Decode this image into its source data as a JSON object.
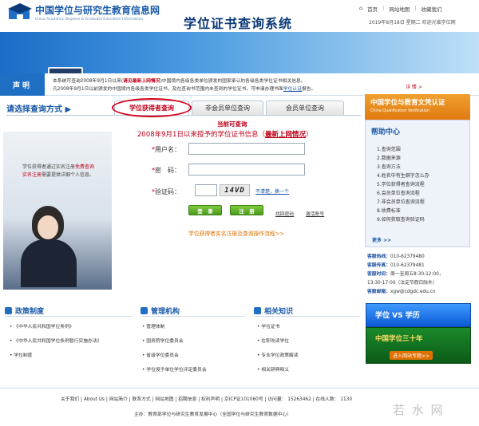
{
  "header": {
    "site_title": "中国学位与研究生教育信息网",
    "site_subtitle": "China Academic Degrees & Graduate Education Information",
    "top_links": [
      "首页",
      "网站地图",
      "收藏我们"
    ],
    "date": "2019年8月18日 星期二",
    "welcome": "欢迎光临学位网"
  },
  "banner": {
    "title": "学位证书查询系统"
  },
  "notice": {
    "label": "声明",
    "line1_a": "本系统可查询2008年9月1日以来(",
    "line1_link": "请见最新上网情况",
    "line1_b": ")中国境内各级各类单位颁发的国家承认的各级各类学位证书相关信息。",
    "line2_a": "凡2008年9月1日以前颁发的中国境内各级各类学位证书，及在查询书范围内未查到的学位证书，可申请办理书面",
    "line2_link": "学位认证",
    "line2_b": "报告。",
    "detail": "详 情 >"
  },
  "query": {
    "label": "请选择查询方式",
    "tabs": [
      "学位获得者查询",
      "非会员单位查询",
      "会员单位查询"
    ]
  },
  "photo": {
    "caption_a": "学位获得者通过实名注册",
    "caption_red": "免费查询",
    "caption_b": "实名注册",
    "caption_c": "需要提供详细个人信息。"
  },
  "form": {
    "current_label": "当前可查询",
    "scope_a": "2008年9月1日以来授予的学位证书信息（",
    "scope_link": "最新上网情况",
    "scope_b": "）",
    "user_label": "用户名：",
    "pwd_label": "密　码：",
    "captcha_label": "验证码：",
    "user_value": "",
    "pwd_value": "",
    "captcha_value": "",
    "captcha_text": "14VD",
    "refresh_text": "不清楚，换一个",
    "login_btn": "登　录",
    "register_btn": "注　册",
    "forgot_link": "找回密码",
    "activate_link": "激活账号",
    "process_link": "学位获得者实名注册及查询操作流程>>"
  },
  "right": {
    "cert_title": "中国学位与教育文凭认证",
    "cert_sub": "China Qualification Verification",
    "help_title": "帮助中心",
    "help_items": [
      "1.查询范围",
      "2.数据来源",
      "3.查询方法",
      "4.姓名中有生僻字怎么办",
      "5.学位获得者查询流程",
      "6.会员单位查询流程",
      "7.非会员单位查询流程",
      "8.收费标准",
      "9.如何获取查询验证码"
    ],
    "help_more": "更多 >>",
    "hotline_label": "客服热线：",
    "hotline": "010-62379480",
    "fax_label": "客服传真：",
    "fax": "010-62379481",
    "hours_label": "客服时间：",
    "hours_a": "周一至周五8:30-12:00，",
    "hours_b": "13:30-17:00（法定节假日除外）",
    "email_label": "客服邮箱：",
    "email": "xgw@cdgdc.edu.cn"
  },
  "sections": {
    "policy_title": "政策制度",
    "policy_items": [
      "《中华人民共和国学位条例》",
      "《中华人民共和国学位条例暂行实施办法》",
      "学位制度"
    ],
    "orgs_title": "管理机构",
    "orgs_items": [
      "管理体制",
      "国务院学位委员会",
      "省级学位委员会",
      "学位授予单位学位评定委员会"
    ],
    "knowledge_title": "相关知识",
    "knowledge_items": [
      "学位证书",
      "在职攻读学位",
      "专业学位政策解读",
      "相关辞典释义"
    ]
  },
  "ads": {
    "top_text": "学位 VS 学历",
    "bottom_text": "中国学位三十年",
    "bottom_btn": "进入网站专题>>"
  },
  "footer": {
    "links": "关于我们 | About Us | 网站简介 | 联系方式 | 网站地图 | 招聘信息 | 权利声明 | 京ICP证101060号 | 访问量： 15263462 | 在线人数： 1130",
    "host": "主办：教育部学位与研究生教育发展中心（全国学位与研究生教育数据中心）",
    "watermark": "若 水 网"
  },
  "colors": {
    "brand_blue": "#1a5aa8",
    "accent_red": "#c0001a",
    "orange": "#e07a10",
    "green_btn": "#4a9a1c"
  }
}
